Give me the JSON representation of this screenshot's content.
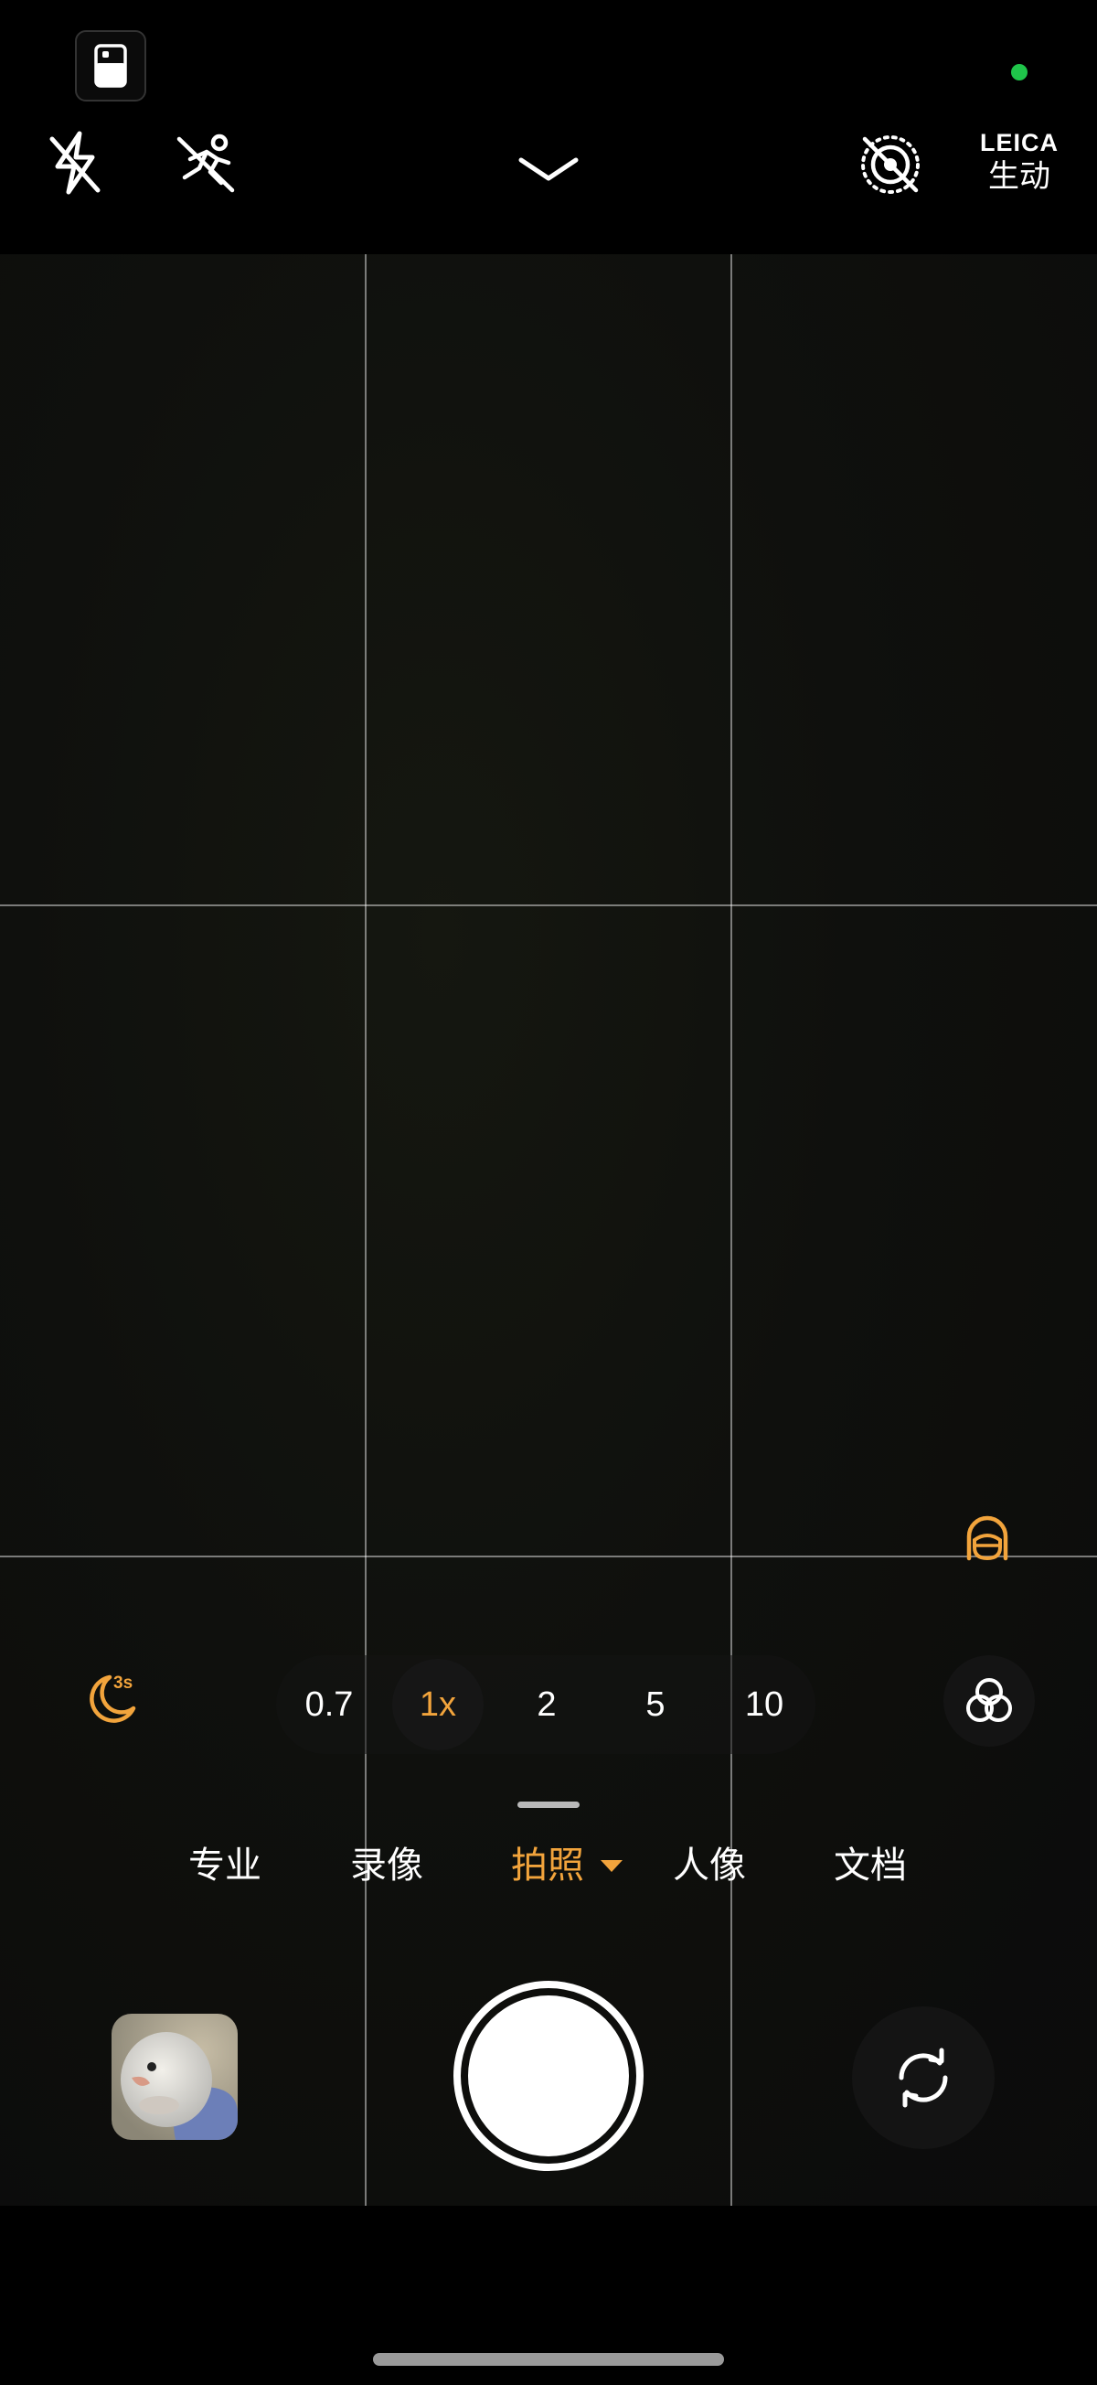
{
  "topbar": {
    "leica_brand": "LEICA",
    "leica_style": "生动"
  },
  "zoom": {
    "options": [
      "0.7",
      "1x",
      "2",
      "5",
      "10"
    ],
    "active": "1x",
    "night_timer_label": "3s"
  },
  "modes": {
    "items": [
      "专业",
      "录像",
      "拍照",
      "人像",
      "文档"
    ],
    "active": "拍照"
  },
  "colors": {
    "accent": "#f2a43c",
    "recording_indicator": "#1fc54a",
    "background": "#000000"
  },
  "icons": {
    "top": [
      "sim-card-icon",
      "flash-off-icon",
      "motion-capture-off-icon",
      "chevron-down-icon",
      "live-photo-off-icon"
    ],
    "viewfinder": [
      "portrait-face-icon"
    ],
    "controls": [
      "night-mode-moon-icon",
      "filters-icon",
      "camera-flip-icon"
    ]
  }
}
